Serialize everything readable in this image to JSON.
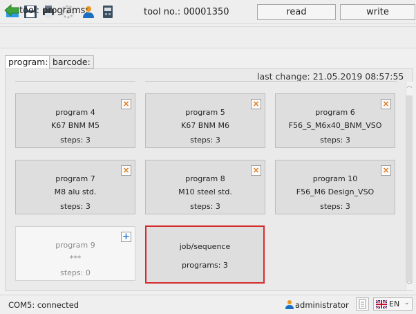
{
  "toolbar": {
    "tool_label": "tool no.: 00001350",
    "read_label": "read",
    "write_label": "write",
    "icons": [
      "folder-open-icon",
      "save-icon",
      "print-icon",
      "settings-icon",
      "user-icon",
      "device-icon"
    ]
  },
  "nav": {
    "title": "tool: programs:"
  },
  "tabs": [
    {
      "label": "program:",
      "active": true
    },
    {
      "label": "barcode:",
      "active": false
    }
  ],
  "main": {
    "last_change": "last change: 21.05.2019  08:57:55",
    "programs": [
      {
        "title": "program 4",
        "name": "K67 BNM M5",
        "steps": "steps: 3"
      },
      {
        "title": "program 5",
        "name": "K67 BNM M6",
        "steps": "steps: 3"
      },
      {
        "title": "program 6",
        "name": "F56_S_M6x40_BNM_VSO",
        "steps": "steps: 3"
      },
      {
        "title": "program 7",
        "name": "M8 alu std.",
        "steps": "steps: 3"
      },
      {
        "title": "program 8",
        "name": "M10 steel std.",
        "steps": "steps: 3"
      },
      {
        "title": "program 10",
        "name": "F56_M6 Design_VSO",
        "steps": "steps: 3"
      }
    ],
    "new_program": {
      "title": "program 9",
      "name": "***",
      "steps": "steps: 0"
    },
    "job": {
      "title": "job/sequence",
      "programs": "programs: 3"
    },
    "delete_glyph": "×",
    "add_glyph": "+"
  },
  "status": {
    "connection": "COM5: connected",
    "user": "administrator",
    "language": "EN"
  },
  "colors": {
    "accent_red": "#d52b2b",
    "delete_orange": "#e07b1a",
    "add_blue": "#2a7fd4"
  }
}
